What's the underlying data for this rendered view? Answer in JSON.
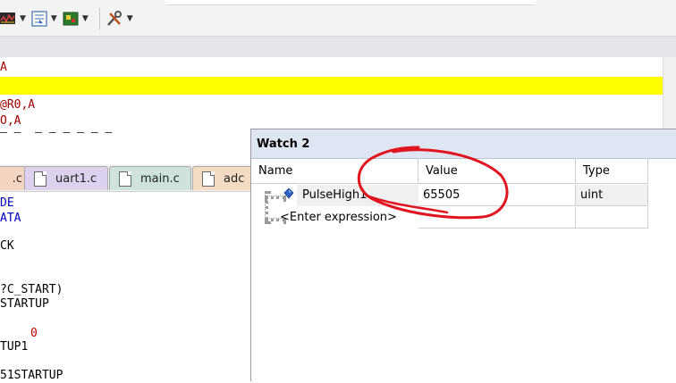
{
  "toolbar": {
    "buttons": [
      {
        "icon": "logic-analyzer-icon"
      },
      {
        "icon": "trace-icon"
      },
      {
        "icon": "system-viewer-icon"
      },
      {
        "icon": "tools-icon"
      }
    ]
  },
  "disassembly": {
    "lines": [
      "A",
      "",
      "@R0,A",
      "O,A",
      "— —  — — — — — —"
    ]
  },
  "editor": {
    "tabs": [
      ".c",
      "uart1.c",
      "main.c",
      "adc"
    ],
    "tab_colors": [
      "#f3d5c2",
      "#dcd2ef",
      "#cfe3dc",
      "#f4dcc4"
    ],
    "code_lines": [
      {
        "text": "DE",
        "cls": "kw"
      },
      {
        "text": "ATA",
        "cls": "kw"
      },
      {
        "text": "",
        "cls": ""
      },
      {
        "text": "CK",
        "cls": ""
      },
      {
        "text": "",
        "cls": ""
      },
      {
        "text": "",
        "cls": ""
      },
      {
        "text": "?C_START)",
        "cls": ""
      },
      {
        "text": "STARTUP",
        "cls": ""
      },
      {
        "text": "",
        "cls": ""
      },
      {
        "text": "0",
        "cls": "num"
      },
      {
        "text": "TUP1",
        "cls": ""
      },
      {
        "text": "",
        "cls": ""
      },
      {
        "text": "51STARTUP",
        "cls": ""
      }
    ]
  },
  "watch": {
    "title": "Watch 2",
    "columns": {
      "name": "Name",
      "value": "Value",
      "type": "Type"
    },
    "rows": [
      {
        "name": "PulseHigh1",
        "value": "65505",
        "type": "uint"
      },
      {
        "name": "<Enter expression>",
        "value": "",
        "type": ""
      }
    ]
  },
  "colors": {
    "highlight": "#ffff00",
    "annotation": "#e0141e"
  }
}
